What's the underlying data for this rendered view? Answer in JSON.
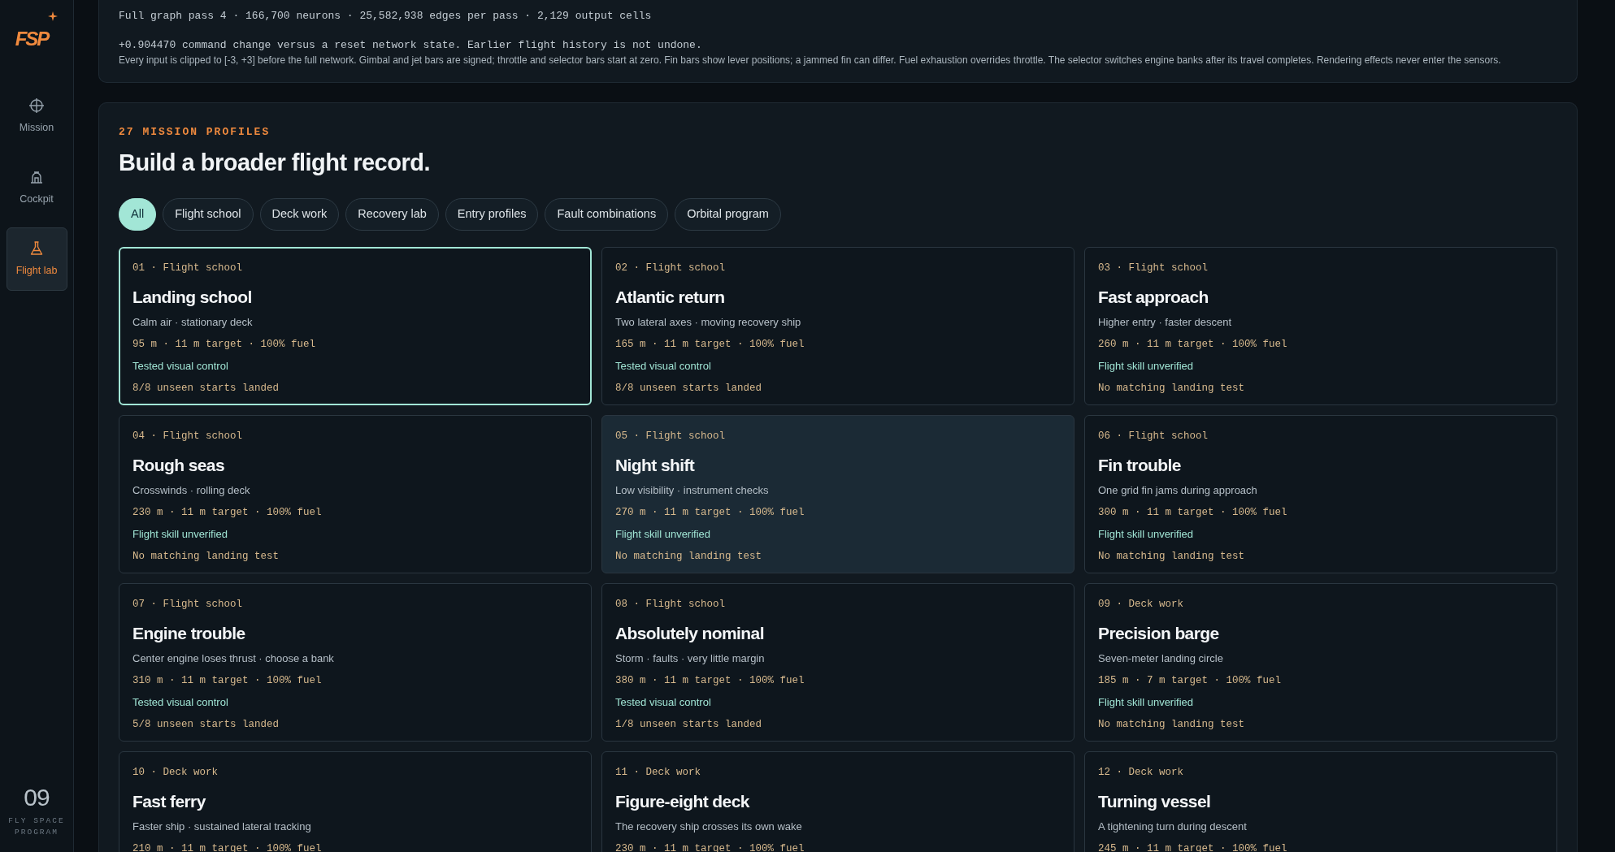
{
  "sidebar": {
    "logo": "FSP",
    "items": [
      {
        "label": "Mission",
        "selected": false
      },
      {
        "label": "Cockpit",
        "selected": false
      },
      {
        "label": "Flight lab",
        "selected": true
      }
    ],
    "footer": {
      "number": "09",
      "caption": "FLY SPACE PROGRAM"
    }
  },
  "network_panel": {
    "pass_line": "Full graph pass 4 · 166,700 neurons · 25,582,938 edges per pass · 2,129 output cells",
    "change_line": "+0.904470 command change versus a reset network state. Earlier flight history is not undone.",
    "note": "Every input is clipped to [-3, +3] before the full network. Gimbal and jet bars are signed; throttle and selector bars start at zero. Fin bars show lever positions; a jammed fin can differ. Fuel exhaustion overrides throttle. The selector switches engine banks after its travel completes. Rendering effects never enter the sensors."
  },
  "profiles": {
    "eyebrow": "27 MISSION PROFILES",
    "title": "Build a broader flight record.",
    "filters": [
      {
        "label": "All",
        "selected": true
      },
      {
        "label": "Flight school",
        "selected": false
      },
      {
        "label": "Deck work",
        "selected": false
      },
      {
        "label": "Recovery lab",
        "selected": false
      },
      {
        "label": "Entry profiles",
        "selected": false
      },
      {
        "label": "Fault combinations",
        "selected": false
      },
      {
        "label": "Orbital program",
        "selected": false
      }
    ],
    "cards": [
      {
        "tag": "01 · Flight school",
        "title": "Landing school",
        "subtitle": "Calm air · stationary deck",
        "stats": "95 m · 11 m target · 100% fuel",
        "status": "Tested visual control",
        "result": "8/8 unseen starts landed",
        "selected": true,
        "highlighted": false
      },
      {
        "tag": "02 · Flight school",
        "title": "Atlantic return",
        "subtitle": "Two lateral axes · moving recovery ship",
        "stats": "165 m · 11 m target · 100% fuel",
        "status": "Tested visual control",
        "result": "8/8 unseen starts landed",
        "selected": false,
        "highlighted": false
      },
      {
        "tag": "03 · Flight school",
        "title": "Fast approach",
        "subtitle": "Higher entry · faster descent",
        "stats": "260 m · 11 m target · 100% fuel",
        "status": "Flight skill unverified",
        "result": "No matching landing test",
        "selected": false,
        "highlighted": false
      },
      {
        "tag": "04 · Flight school",
        "title": "Rough seas",
        "subtitle": "Crosswinds · rolling deck",
        "stats": "230 m · 11 m target · 100% fuel",
        "status": "Flight skill unverified",
        "result": "No matching landing test",
        "selected": false,
        "highlighted": false
      },
      {
        "tag": "05 · Flight school",
        "title": "Night shift",
        "subtitle": "Low visibility · instrument checks",
        "stats": "270 m · 11 m target · 100% fuel",
        "status": "Flight skill unverified",
        "result": "No matching landing test",
        "selected": false,
        "highlighted": true
      },
      {
        "tag": "06 · Flight school",
        "title": "Fin trouble",
        "subtitle": "One grid fin jams during approach",
        "stats": "300 m · 11 m target · 100% fuel",
        "status": "Flight skill unverified",
        "result": "No matching landing test",
        "selected": false,
        "highlighted": false
      },
      {
        "tag": "07 · Flight school",
        "title": "Engine trouble",
        "subtitle": "Center engine loses thrust · choose a bank",
        "stats": "310 m · 11 m target · 100% fuel",
        "status": "Tested visual control",
        "result": "5/8 unseen starts landed",
        "selected": false,
        "highlighted": false
      },
      {
        "tag": "08 · Flight school",
        "title": "Absolutely nominal",
        "subtitle": "Storm · faults · very little margin",
        "stats": "380 m · 11 m target · 100% fuel",
        "status": "Tested visual control",
        "result": "1/8 unseen starts landed",
        "selected": false,
        "highlighted": false
      },
      {
        "tag": "09 · Deck work",
        "title": "Precision barge",
        "subtitle": "Seven-meter landing circle",
        "stats": "185 m · 7 m target · 100% fuel",
        "status": "Flight skill unverified",
        "result": "No matching landing test",
        "selected": false,
        "highlighted": false
      },
      {
        "tag": "10 · Deck work",
        "title": "Fast ferry",
        "subtitle": "Faster ship · sustained lateral tracking",
        "stats": "210 m · 11 m target · 100% fuel",
        "selected": false,
        "highlighted": false
      },
      {
        "tag": "11 · Deck work",
        "title": "Figure-eight deck",
        "subtitle": "The recovery ship crosses its own wake",
        "stats": "230 m · 11 m target · 100% fuel",
        "selected": false,
        "highlighted": false
      },
      {
        "tag": "12 · Deck work",
        "title": "Turning vessel",
        "subtitle": "A tightening turn during descent",
        "stats": "245 m · 11 m target · 100% fuel",
        "selected": false,
        "highlighted": false
      }
    ]
  }
}
